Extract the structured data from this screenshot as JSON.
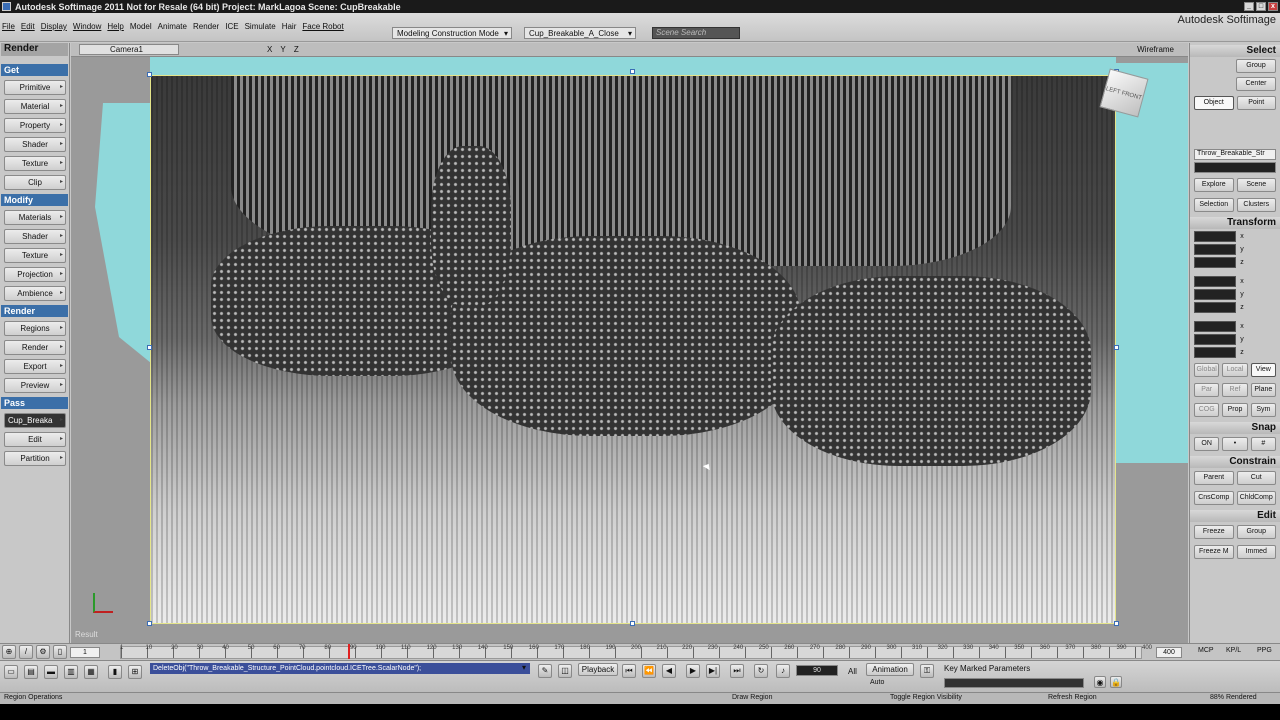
{
  "titlebar": {
    "text": "Autodesk Softimage 2011   Not for Resale (64 bit)   Project: MarkLagoa   Scene: CupBreakable"
  },
  "menubar": {
    "items": [
      "File",
      "Edit",
      "Display",
      "Window",
      "Help",
      "Model",
      "Animate",
      "Render",
      "ICE",
      "Simulate",
      "Hair",
      "Face Robot"
    ],
    "mode_dropdown": "Modeling Construction Mode",
    "camera_preset": "Cup_Breakable_A_Close",
    "search_placeholder": "Scene Search",
    "brand": "Autodesk Softimage"
  },
  "left_panel": {
    "top_title": "Render",
    "get_header": "Get",
    "get_items": [
      "Primitive",
      "Material",
      "Property",
      "Shader",
      "Texture",
      "Clip"
    ],
    "modify_header": "Modify",
    "modify_items": [
      "Materials",
      "Shader",
      "Texture",
      "Projection",
      "Ambience"
    ],
    "render_header": "Render",
    "render_items": [
      "Regions",
      "Render",
      "Export",
      "Preview"
    ],
    "pass_header": "Pass",
    "pass_value": "Cup_Breaka",
    "pass_items": [
      "Edit",
      "Partition"
    ]
  },
  "viewport": {
    "camera": "Camera1",
    "axes": "X Y Z",
    "display_mode": "Wireframe",
    "result_label": "Result",
    "navcube_label": "LEFT  FRONT"
  },
  "right_panel": {
    "select_header": "Select",
    "select_buttons": [
      "Group",
      "Center",
      "Object",
      "Point"
    ],
    "object_name": "Throw_Breakable_Str",
    "explore_buttons": [
      "Explore",
      "Scene",
      "Selection",
      "Clusters"
    ],
    "transform_header": "Transform",
    "axis_labels": [
      "x",
      "y",
      "z"
    ],
    "ref_buttons": [
      "Global",
      "Local",
      "View"
    ],
    "ref_buttons2": [
      "Par",
      "Ref",
      "Plane"
    ],
    "cog_buttons": [
      "COG",
      "Prop",
      "Sym"
    ],
    "snap_header": "Snap",
    "snap_on": "ON",
    "constrain_header": "Constrain",
    "constrain_buttons": [
      "Parent",
      "Cut",
      "CnsComp",
      "ChldComp"
    ],
    "edit_header": "Edit",
    "edit_buttons": [
      "Freeze",
      "Group",
      "Freeze M",
      "Immed"
    ]
  },
  "timeline": {
    "start_frame": "1",
    "end_frame": "400",
    "ticks": [
      "1",
      "10",
      "20",
      "30",
      "40",
      "50",
      "60",
      "70",
      "80",
      "90",
      "100",
      "110",
      "120",
      "130",
      "140",
      "150",
      "160",
      "170",
      "180",
      "190",
      "200",
      "210",
      "220",
      "230",
      "240",
      "250",
      "260",
      "270",
      "280",
      "290",
      "300",
      "310",
      "320",
      "330",
      "340",
      "350",
      "360",
      "370",
      "380",
      "390",
      "400"
    ],
    "current_frame": 90,
    "right_labels": [
      "MCP",
      "KP/L",
      "PPG"
    ]
  },
  "toolbar": {
    "command": "DeleteObj(\"Throw_Breakable_Structure_PointCloud.pointcloud.ICETree.ScalarNode\");",
    "playback_label": "Playback",
    "frame_field": "90",
    "all_label": "All",
    "animation_label": "Animation",
    "auto_label": "Auto",
    "key_marked": "Key Marked Parameters"
  },
  "statusbar": {
    "left": "Region Operations",
    "mid1": "Draw Region",
    "mid2": "Toggle Region Visibility",
    "mid3": "Refresh Region",
    "right": "88%  Rendered"
  }
}
